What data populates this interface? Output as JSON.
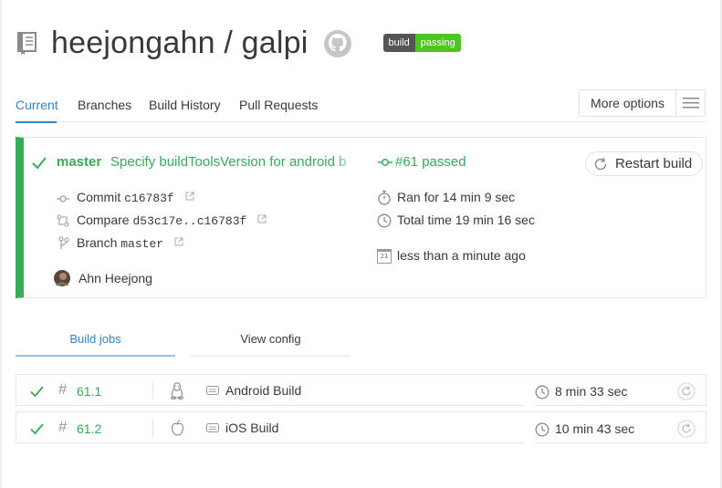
{
  "header": {
    "icon": "repo-book-icon",
    "title": "heejongahn / galpi",
    "github_icon": "github-icon",
    "badge": {
      "left": "build",
      "right": "passing",
      "color": "#4cc61e"
    }
  },
  "tabs": [
    {
      "label": "Current",
      "active": true
    },
    {
      "label": "Branches",
      "active": false
    },
    {
      "label": "Build History",
      "active": false
    },
    {
      "label": "Pull Requests",
      "active": false
    }
  ],
  "more_options": {
    "label": "More options",
    "icon": "hamburger-icon"
  },
  "build": {
    "status_color": "#39aa56",
    "branch": "master",
    "message": "Specify buildToolsVersion for android build",
    "number_status": "#61 passed",
    "restart_label": "Restart build",
    "commit_label": "Commit",
    "commit_hash": "c16783f",
    "compare_label": "Compare",
    "compare_range": "d53c17e..c16783f",
    "branch_label": "Branch",
    "branch_name": "master",
    "author": "Ahn Heejong",
    "ran_for": "Ran for 14 min 9 sec",
    "total_time": "Total time 19 min 16 sec",
    "finished": "less than a minute ago",
    "calendar_day": "21"
  },
  "subtabs": [
    {
      "label": "Build jobs",
      "active": true
    },
    {
      "label": "View config",
      "active": false
    }
  ],
  "jobs": [
    {
      "number": "61.1",
      "os_icon": "linux-icon",
      "name": "Android Build",
      "duration": "8 min 33 sec"
    },
    {
      "number": "61.2",
      "os_icon": "apple-icon",
      "name": "iOS Build",
      "duration": "10 min 43 sec"
    }
  ]
}
